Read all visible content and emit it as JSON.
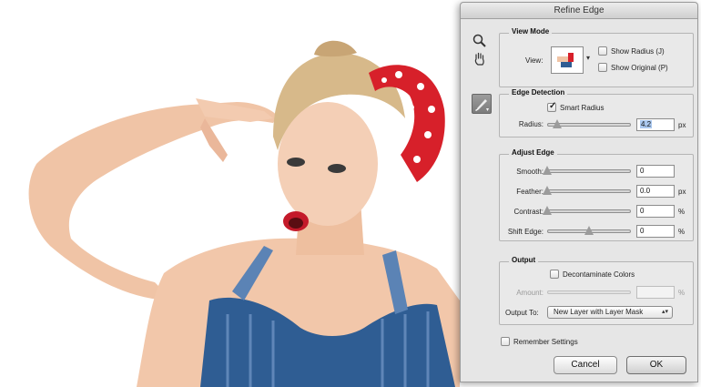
{
  "dialog": {
    "title": "Refine Edge",
    "view_mode": {
      "legend": "View Mode",
      "view_label": "View:",
      "show_radius": {
        "label": "Show Radius (J)",
        "checked": false
      },
      "show_original": {
        "label": "Show Original (P)",
        "checked": false
      }
    },
    "edge_detection": {
      "legend": "Edge Detection",
      "smart_radius": {
        "label": "Smart Radius",
        "checked": true
      },
      "radius": {
        "label": "Radius:",
        "value": "4.2",
        "unit": "px",
        "slider_fraction": 0.12
      }
    },
    "adjust_edge": {
      "legend": "Adjust Edge",
      "smooth": {
        "label": "Smooth:",
        "value": "0",
        "unit": "",
        "slider_fraction": 0.0
      },
      "feather": {
        "label": "Feather:",
        "value": "0.0",
        "unit": "px",
        "slider_fraction": 0.0
      },
      "contrast": {
        "label": "Contrast:",
        "value": "0",
        "unit": "%",
        "slider_fraction": 0.0
      },
      "shift": {
        "label": "Shift Edge:",
        "value": "0",
        "unit": "%",
        "slider_fraction": 0.5
      }
    },
    "output": {
      "legend": "Output",
      "decontaminate": {
        "label": "Decontaminate Colors",
        "checked": false
      },
      "amount": {
        "label": "Amount:",
        "value": "",
        "unit": "%"
      },
      "output_to_label": "Output To:",
      "output_to_value": "New Layer with Layer Mask"
    },
    "remember": {
      "label": "Remember Settings",
      "checked": false
    },
    "cancel_label": "Cancel",
    "ok_label": "OK"
  },
  "icons": {
    "zoom": "zoom-icon",
    "hand": "hand-icon",
    "brush": "refine-radius-brush-icon"
  },
  "colors": {
    "dialog_bg": "#e6e6e6",
    "field_selection": "#aac8ef"
  }
}
